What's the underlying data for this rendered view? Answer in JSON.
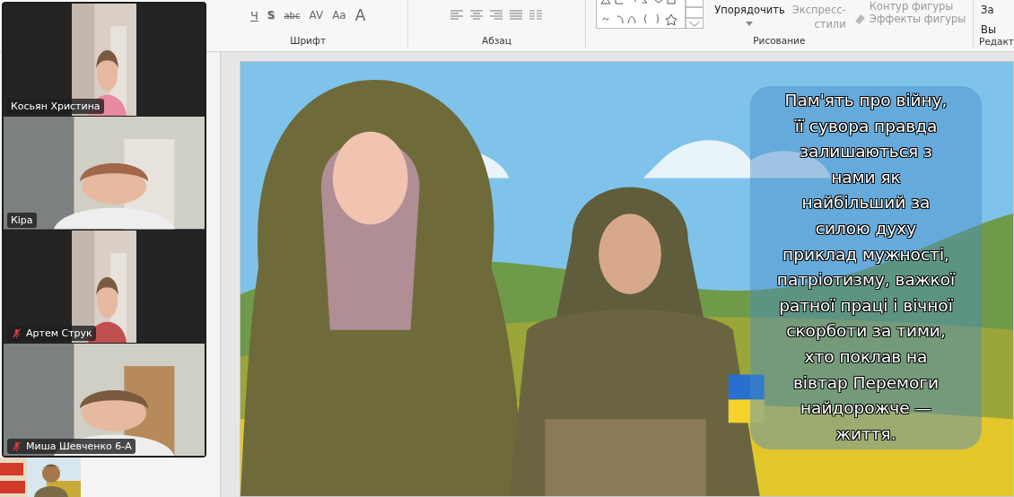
{
  "ribbon": {
    "groups": [
      {
        "kind": "font",
        "label": "Шрифт",
        "items": [
          "Ч",
          "S",
          "abc",
          "AV",
          "Aa",
          "A"
        ]
      },
      {
        "kind": "paragraph",
        "label": "Абзац"
      },
      {
        "kind": "drawing",
        "label": "Рисование",
        "items": [
          "Упорядочить",
          "Экспресс-",
          "стили",
          "Контур фигуры",
          "Эффекты фигуры"
        ]
      },
      {
        "kind": "editing",
        "label": "Редакт",
        "items": [
          "За",
          "Вы"
        ]
      }
    ]
  },
  "video_panel": {
    "participants": [
      {
        "name": "Косьян Христина",
        "muted": false,
        "kind": "narrow"
      },
      {
        "name": "Кіра",
        "muted": false,
        "kind": "wide"
      },
      {
        "name": "Артем Струк",
        "muted": true,
        "kind": "narrow"
      },
      {
        "name": "Миша Шевченко 6-А",
        "muted": true,
        "kind": "wide"
      }
    ]
  },
  "slide": {
    "text_lines": [
      "Пам'ять про війну,",
      "її сувора правда",
      "залишаються з",
      "нами як",
      "найбільший за",
      "силою духу",
      "приклад мужності,",
      "патріотизму, важкої",
      "ратної праці і вічної",
      "скорботи за тими,",
      "хто поклав на",
      "вівтар Перемоги",
      "найдорожче —",
      "життя."
    ]
  }
}
